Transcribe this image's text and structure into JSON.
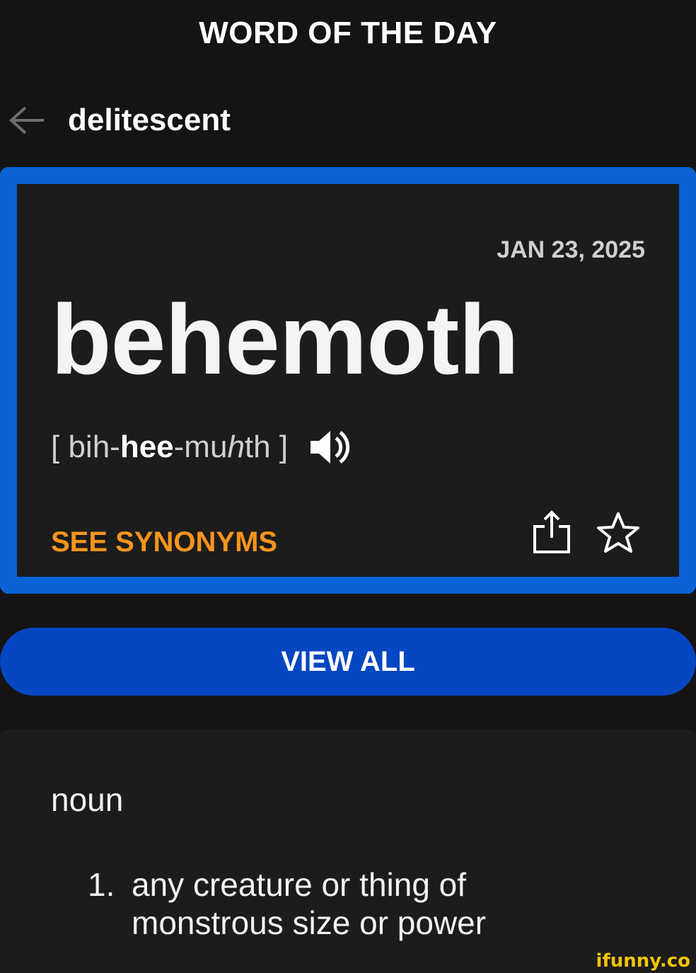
{
  "header": {
    "title": "WORD OF THE DAY",
    "previous_word": "delitescent"
  },
  "card": {
    "date": "JAN 23, 2025",
    "word": "behemoth",
    "pronunciation": {
      "open": "[ ",
      "part1": "bih-",
      "stressed": "hee",
      "part2": "-mu",
      "italic": "h",
      "part3": "th",
      "close": " ]"
    },
    "synonyms_label": "SEE SYNONYMS",
    "colors": {
      "border": "#0a62d6",
      "synonyms": "#f7941d"
    }
  },
  "view_all_label": "VIEW ALL",
  "definition": {
    "part_of_speech": "noun",
    "items": [
      {
        "number": "1.",
        "text": "any creature or thing of monstrous size or power"
      }
    ]
  },
  "watermark": "ifunny.co"
}
